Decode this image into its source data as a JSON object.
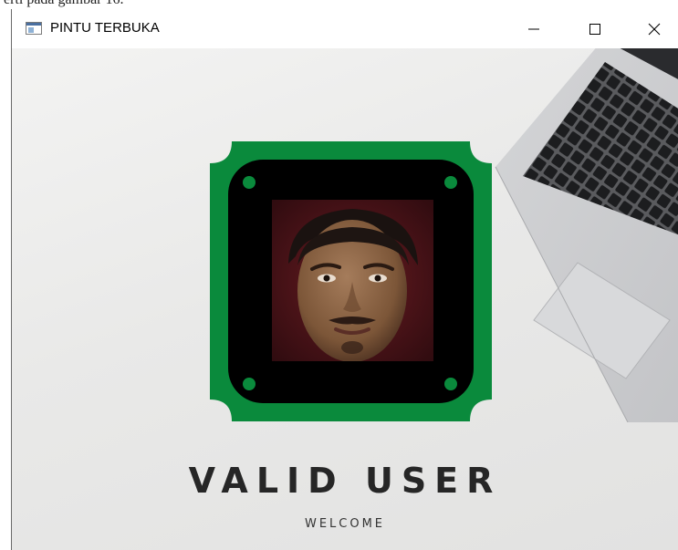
{
  "page": {
    "caption_fragment": "erti pada gambar 16."
  },
  "window": {
    "title": "PINTU TERBUKA",
    "controls": {
      "minimize_icon": "minimize-icon",
      "maximize_icon": "maximize-icon",
      "close_icon": "close-icon"
    }
  },
  "screen": {
    "headline": "VALID USER",
    "subline": "WELCOME"
  },
  "colors": {
    "frame_green": "#0a8a3c",
    "frame_black": "#000000",
    "dot_green": "#0a8a3c",
    "headline_text": "#262626"
  }
}
